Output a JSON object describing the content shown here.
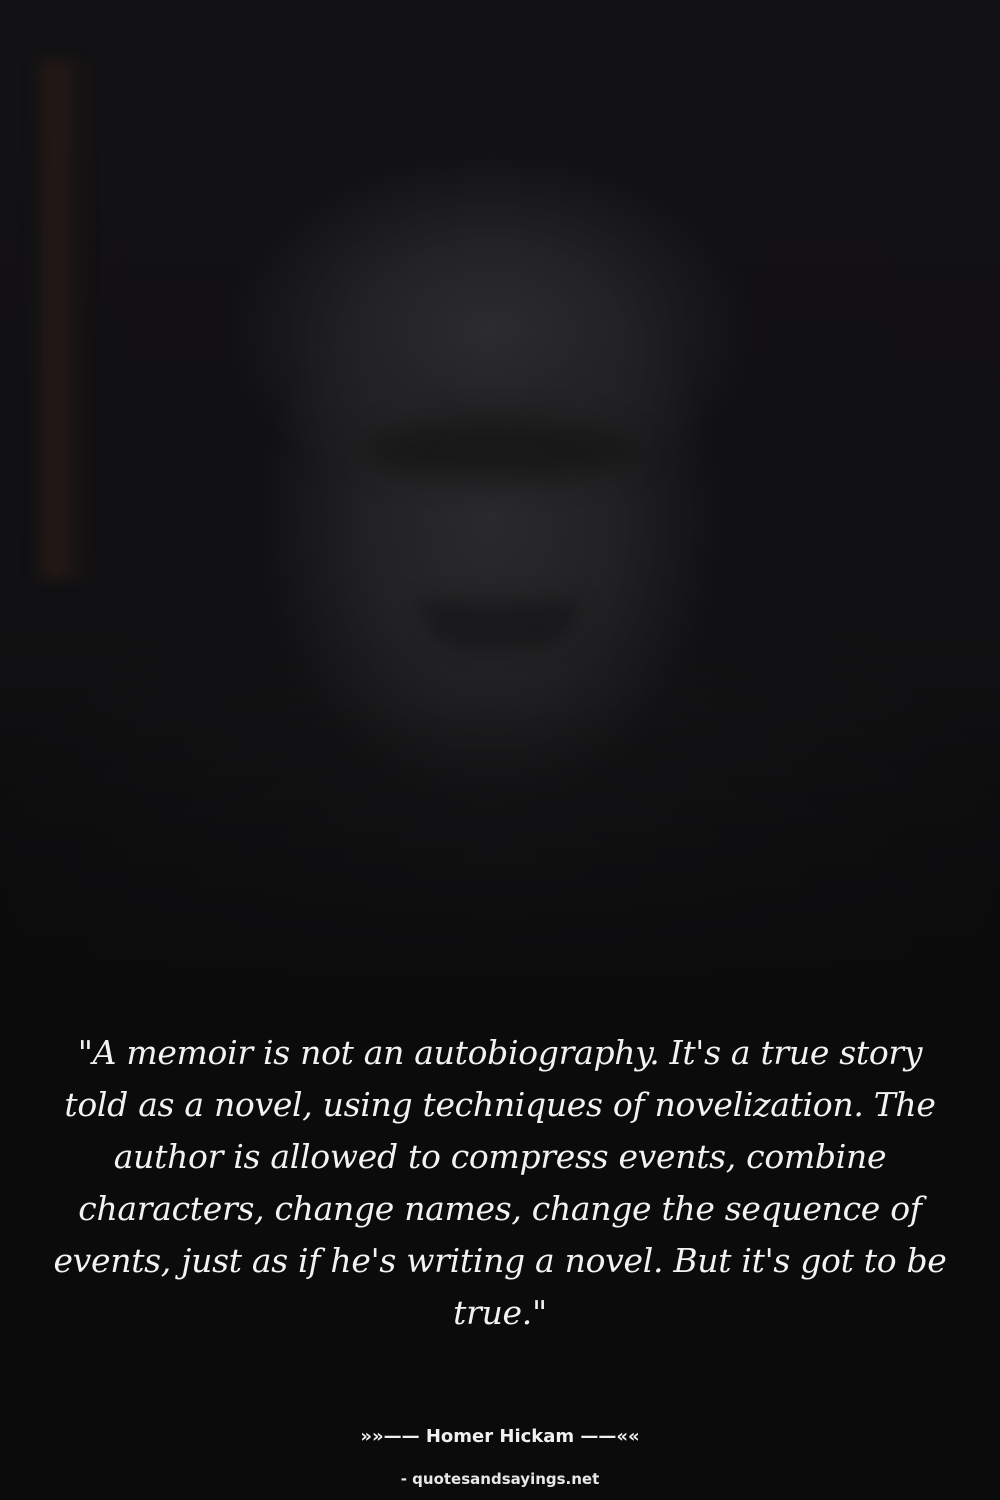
{
  "photo": {
    "subject": "portrait-photo"
  },
  "quote": {
    "text": "\"A memoir is not an autobiography. It's a true story told as a novel, using techniques of novelization. The author is allowed to compress events, combine characters, change names, change the sequence of events, just as if he's writing a novel. But it's got to be true.\""
  },
  "author": {
    "text": "»»—— Homer Hickam ——««"
  },
  "source": {
    "text": "- quotesandsayings.net"
  },
  "colors": {
    "background": "#0b0b0c",
    "text": "#f2f2f2"
  }
}
